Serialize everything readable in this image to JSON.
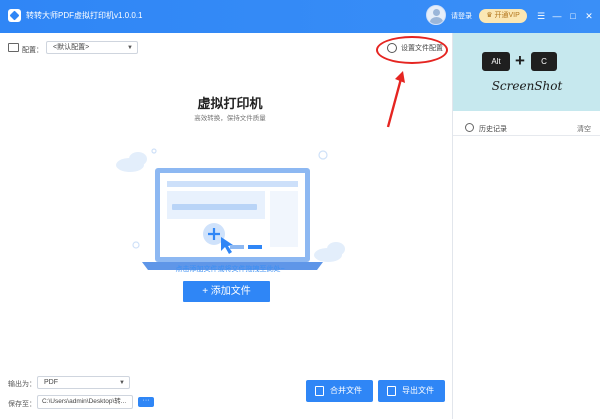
{
  "titlebar": {
    "app_title": "转转大师PDF虚拟打印机v1.0.0.1",
    "login_text": "请登录",
    "vip_label": "开通VIP",
    "controls": [
      "☰",
      "—",
      "□",
      "✕"
    ]
  },
  "toolbar": {
    "config_label": "配置：",
    "config_value": "<默认配置>",
    "set_file_config_label": "设置文件配置"
  },
  "main": {
    "title": "虚拟打印机",
    "subtitle": "高效转换，保持文件质量",
    "hint": "点击添加文件或将文件拖拽至此处~",
    "add_file_label": "+ 添加文件"
  },
  "footer": {
    "output_label": "输出为：",
    "output_value": "PDF",
    "save_label": "保存至：",
    "save_path": "C:\\Users\\admin\\Desktop\\转...",
    "browse_label": "···",
    "merge_label": "合并文件",
    "export_label": "导出文件"
  },
  "sidebar": {
    "key_alt": "Alt",
    "key_plus": "+",
    "key_c": "C",
    "banner_text": "ScreenShot",
    "history_label": "历史记录",
    "clear_label": "清空"
  },
  "colors": {
    "accent": "#2f86f6",
    "annotation_red": "#e52521",
    "banner_bg": "#c6e8ee",
    "vip_bg": "#fbe7b4"
  }
}
